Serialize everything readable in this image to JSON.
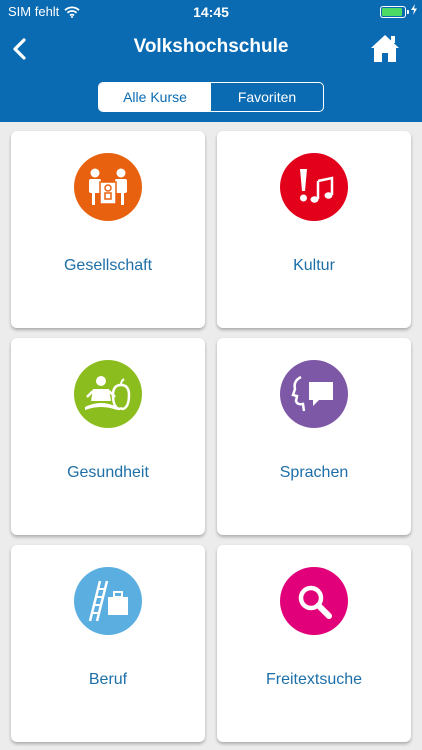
{
  "status": {
    "carrier": "SIM fehlt",
    "time": "14:45",
    "battery_level": 0.95
  },
  "nav": {
    "title": "Volkshochschule"
  },
  "segments": [
    {
      "label": "Alle Kurse",
      "active": true
    },
    {
      "label": "Favoriten",
      "active": false
    }
  ],
  "tiles": [
    {
      "label": "Gesellschaft",
      "icon": "group-presentation-icon",
      "color": "#e8610e"
    },
    {
      "label": "Kultur",
      "icon": "music-brush-icon",
      "color": "#e3001b"
    },
    {
      "label": "Gesundheit",
      "icon": "yoga-apple-icon",
      "color": "#8cbd1f"
    },
    {
      "label": "Sprachen",
      "icon": "speech-face-icon",
      "color": "#7d58a6"
    },
    {
      "label": "Beruf",
      "icon": "ladder-briefcase-icon",
      "color": "#5aaee0"
    },
    {
      "label": "Freitextsuche",
      "icon": "search-icon",
      "color": "#e2007a"
    }
  ],
  "colors": {
    "brand": "#0a6bb3",
    "link": "#1d6fa8"
  }
}
